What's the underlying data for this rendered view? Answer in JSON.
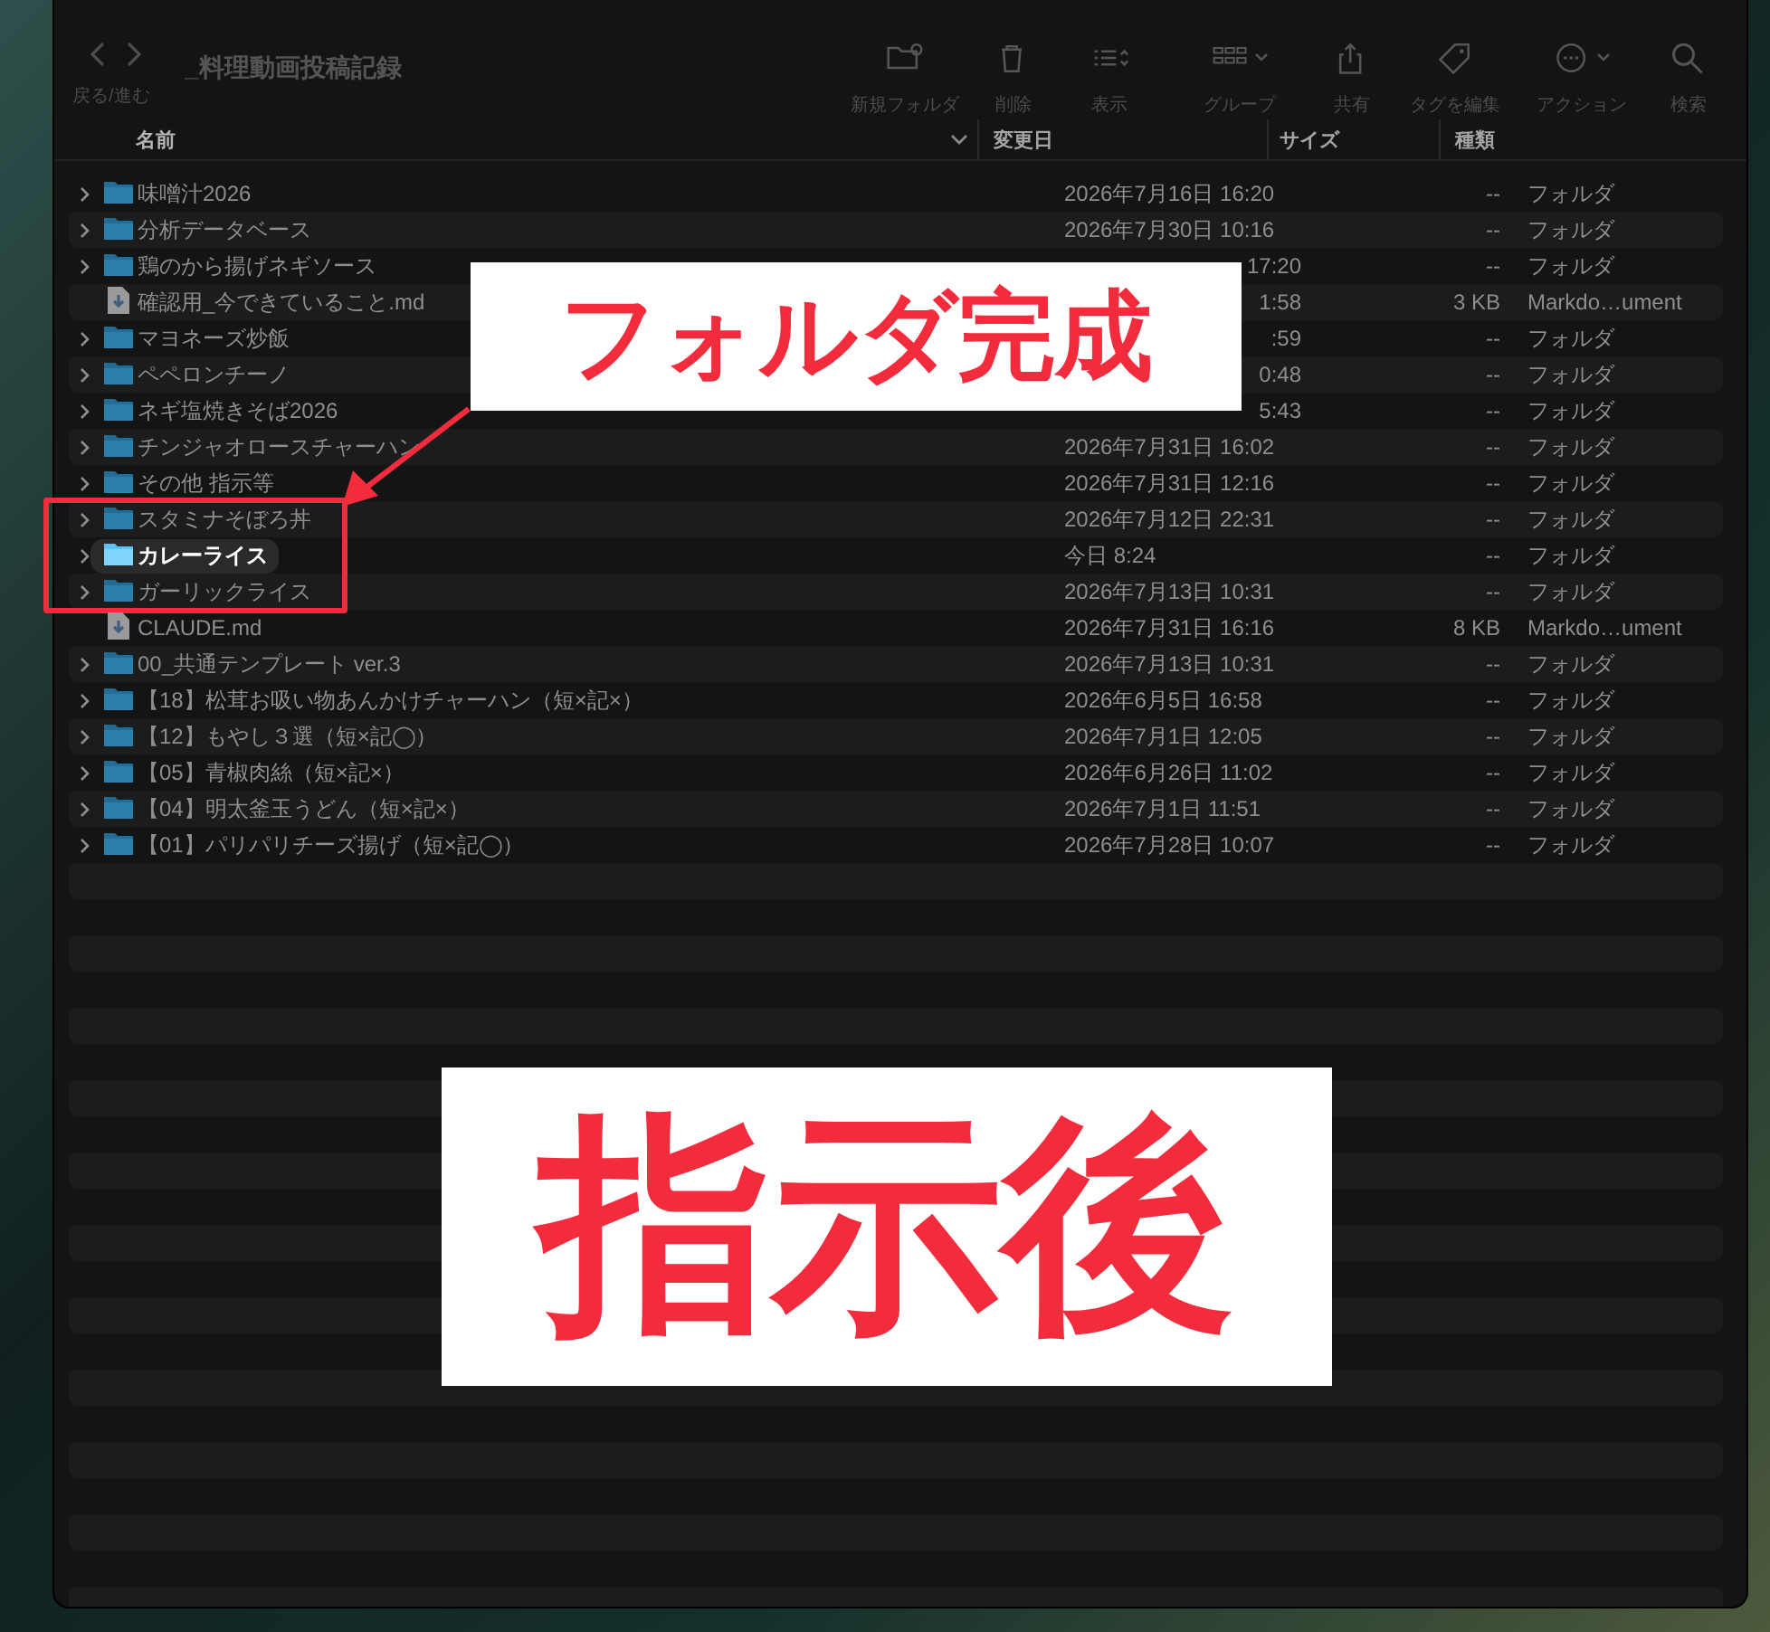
{
  "window": {
    "title": "_料理動画投稿記録",
    "nav_label": "戻る/進む"
  },
  "toolbar": [
    {
      "kind": "new-folder",
      "label": "新規フォルダ"
    },
    {
      "kind": "delete",
      "label": "削除"
    },
    {
      "kind": "view",
      "label": "表示"
    },
    {
      "kind": "group",
      "label": "グループ"
    },
    {
      "kind": "share",
      "label": "共有"
    },
    {
      "kind": "tag",
      "label": "タグを編集"
    },
    {
      "kind": "action",
      "label": "アクション"
    },
    {
      "kind": "search",
      "label": "検索"
    }
  ],
  "columns": [
    {
      "label": "名前",
      "sorted": true
    },
    {
      "label": "変更日",
      "sorted": false
    },
    {
      "label": "サイズ",
      "sorted": false
    },
    {
      "label": "種類",
      "sorted": false
    }
  ],
  "rows": [
    {
      "kind": "folder",
      "name": "味噌汁2026",
      "date": "2026年7月16日 16:20",
      "size": "--",
      "type": "フォルダ",
      "selected": false
    },
    {
      "kind": "folder",
      "name": "分析データベース",
      "date": "2026年7月30日 10:16",
      "size": "--",
      "type": "フォルダ",
      "selected": false
    },
    {
      "kind": "folder",
      "name": "鶏のから揚げネギソース",
      "date": "17:20",
      "date_clipped": true,
      "size": "--",
      "type": "フォルダ",
      "selected": false
    },
    {
      "kind": "file",
      "name": "確認用_今できていること.md",
      "date": "1:58",
      "date_clipped": true,
      "size": "3 KB",
      "type": "Markdo…ument",
      "selected": false
    },
    {
      "kind": "folder",
      "name": "マヨネーズ炒飯",
      "date": ":59",
      "date_clipped": true,
      "size": "--",
      "type": "フォルダ",
      "selected": false
    },
    {
      "kind": "folder",
      "name": "ペペロンチーノ",
      "date": "0:48",
      "date_clipped": true,
      "size": "--",
      "type": "フォルダ",
      "selected": false
    },
    {
      "kind": "folder",
      "name": "ネギ塩焼きそば2026",
      "date": "5:43",
      "date_clipped": true,
      "size": "--",
      "type": "フォルダ",
      "selected": false
    },
    {
      "kind": "folder",
      "name": "チンジャオロースチャーハン",
      "date": "2026年7月31日 16:02",
      "size": "--",
      "type": "フォルダ",
      "selected": false
    },
    {
      "kind": "folder",
      "name": "その他 指示等",
      "date": "2026年7月31日 12:16",
      "size": "--",
      "type": "フォルダ",
      "selected": false
    },
    {
      "kind": "folder",
      "name": "スタミナそぼろ丼",
      "date": "2026年7月12日 22:31",
      "size": "--",
      "type": "フォルダ",
      "selected": false
    },
    {
      "kind": "folder",
      "name": "カレーライス",
      "date": "今日 8:24",
      "size": "--",
      "type": "フォルダ",
      "selected": true
    },
    {
      "kind": "folder",
      "name": "ガーリックライス",
      "date": "2026年7月13日 10:31",
      "size": "--",
      "type": "フォルダ",
      "selected": false
    },
    {
      "kind": "file",
      "name": "CLAUDE.md",
      "date": "2026年7月31日 16:16",
      "size": "8 KB",
      "type": "Markdo…ument",
      "selected": false
    },
    {
      "kind": "folder",
      "name": "00_共通テンプレート ver.3",
      "date": "2026年7月13日 10:31",
      "size": "--",
      "type": "フォルダ",
      "selected": false
    },
    {
      "kind": "folder",
      "name": "【18】松茸お吸い物あんかけチャーハン（短×記×）",
      "date": "2026年6月5日 16:58",
      "size": "--",
      "type": "フォルダ",
      "selected": false
    },
    {
      "kind": "folder",
      "name": "【12】もやし３選（短×記◯）",
      "date": "2026年7月1日 12:05",
      "size": "--",
      "type": "フォルダ",
      "selected": false
    },
    {
      "kind": "folder",
      "name": "【05】青椒肉絲（短×記×）",
      "date": "2026年6月26日 11:02",
      "size": "--",
      "type": "フォルダ",
      "selected": false
    },
    {
      "kind": "folder",
      "name": "【04】明太釜玉うどん（短×記×）",
      "date": "2026年7月1日 11:51",
      "size": "--",
      "type": "フォルダ",
      "selected": false
    },
    {
      "kind": "folder",
      "name": "【01】パリパリチーズ揚げ（短×記◯）",
      "date": "2026年7月28日 10:07",
      "size": "--",
      "type": "フォルダ",
      "selected": false
    }
  ],
  "annotations": {
    "callout": "フォルダ完成",
    "label": "指示後"
  }
}
